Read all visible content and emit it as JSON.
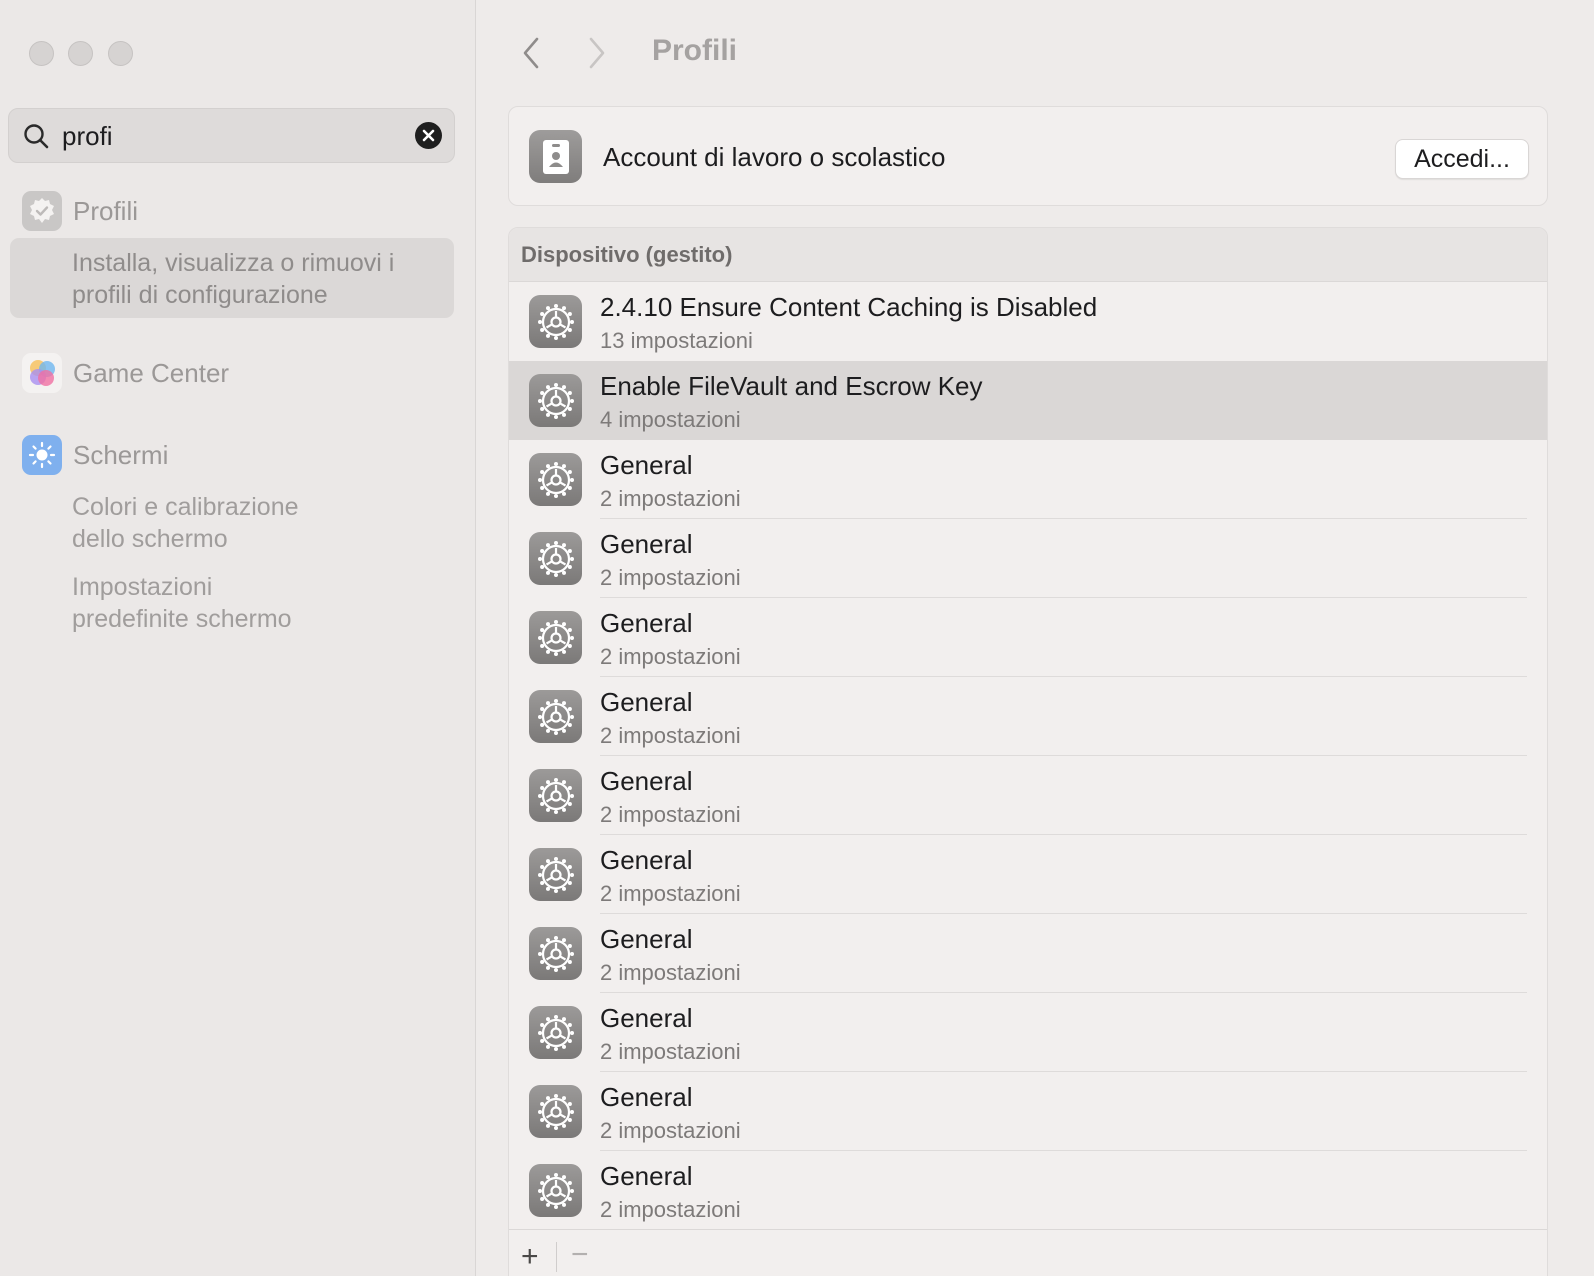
{
  "sidebar": {
    "search": {
      "value": "profi"
    },
    "items": [
      {
        "label": "Profili",
        "icon": "profile-badge-icon"
      },
      {
        "label": "Game Center",
        "icon": "game-center-icon"
      },
      {
        "label": "Schermi",
        "icon": "display-brightness-icon"
      }
    ],
    "results": {
      "profili_desc_line1": "Installa, visualizza o rimuovi i",
      "profili_desc_line2": "profili di configurazione",
      "schermi_sub1_line1": "Colori e calibrazione",
      "schermi_sub1_line2": "dello schermo",
      "schermi_sub2_line1": "Impostazioni",
      "schermi_sub2_line2": "predefinite schermo"
    }
  },
  "main": {
    "title": "Profili",
    "account": {
      "label": "Account di lavoro o scolastico",
      "button": "Accedi..."
    },
    "section_header": "Dispositivo (gestito)",
    "profiles": [
      {
        "title": "2.4.10 Ensure Content Caching is Disabled",
        "subtitle": "13 impostazioni",
        "selected": false
      },
      {
        "title": "Enable FileVault and Escrow Key",
        "subtitle": "4 impostazioni",
        "selected": true
      },
      {
        "title": "General",
        "subtitle": "2 impostazioni",
        "selected": false
      },
      {
        "title": "General",
        "subtitle": "2 impostazioni",
        "selected": false
      },
      {
        "title": "General",
        "subtitle": "2 impostazioni",
        "selected": false
      },
      {
        "title": "General",
        "subtitle": "2 impostazioni",
        "selected": false
      },
      {
        "title": "General",
        "subtitle": "2 impostazioni",
        "selected": false
      },
      {
        "title": "General",
        "subtitle": "2 impostazioni",
        "selected": false
      },
      {
        "title": "General",
        "subtitle": "2 impostazioni",
        "selected": false
      },
      {
        "title": "General",
        "subtitle": "2 impostazioni",
        "selected": false
      },
      {
        "title": "General",
        "subtitle": "2 impostazioni",
        "selected": false
      },
      {
        "title": "General",
        "subtitle": "2 impostazioni",
        "selected": false
      }
    ],
    "footer": {
      "add": "+",
      "remove": "−"
    }
  },
  "colors": {
    "selected_row": "#dad7d6",
    "sidebar_bg": "#ebe8e7",
    "main_bg": "#eeebea"
  }
}
